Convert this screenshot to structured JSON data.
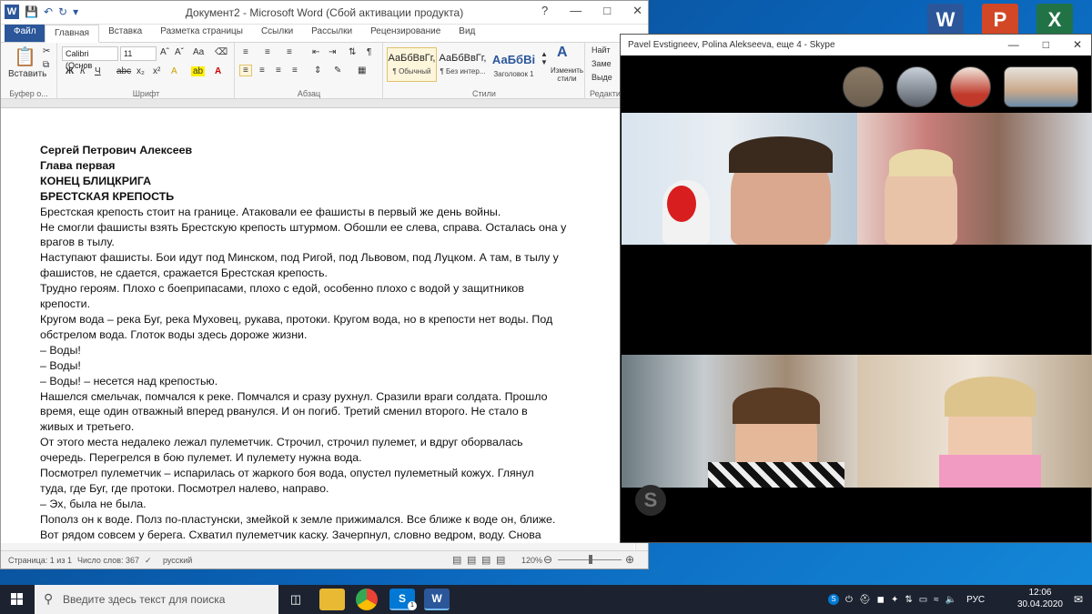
{
  "word": {
    "title": "Документ2 - Microsoft Word (Сбой активации продукта)",
    "tabs": [
      "Файл",
      "Главная",
      "Вставка",
      "Разметка страницы",
      "Ссылки",
      "Рассылки",
      "Рецензирование",
      "Вид"
    ],
    "ribbon": {
      "paste_label": "Вставить",
      "clipboard_group": "Буфер о...",
      "font_name": "Calibri (Основ",
      "font_size": "11",
      "font_group": "Шрифт",
      "paragraph_group": "Абзац",
      "styles_group": "Стили",
      "editing_group": "Редактир",
      "styles": [
        {
          "preview": "АаБбВвГг,",
          "name": "¶ Обычный"
        },
        {
          "preview": "АаБбВвГг,",
          "name": "¶ Без интер..."
        },
        {
          "preview": "АаБбВі",
          "name": "Заголовок 1"
        }
      ],
      "change_styles": "Изменить стили",
      "find": "Найт",
      "replace": "Заме",
      "select": "Выде"
    },
    "document_lines": [
      {
        "text": "Сергей Петрович Алексеев",
        "bold": true
      },
      {
        "text": "Глава первая",
        "bold": true
      },
      {
        "text": "КОНЕЦ БЛИЦКРИГА",
        "bold": true
      },
      {
        "text": "БРЕСТСКАЯ КРЕПОСТЬ",
        "bold": true
      },
      {
        "text": "Брестская крепость стоит на границе. Атаковали ее фашисты в первый же день войны.",
        "bold": false
      },
      {
        "text": "Не смогли фашисты взять Брестскую крепость штурмом. Обошли ее слева, справа. Осталась она у",
        "bold": false
      },
      {
        "text": "врагов в тылу.",
        "bold": false
      },
      {
        "text": "Наступают фашисты. Бои идут под Минском, под Ригой, под Львовом, под Луцком. А там, в тылу у",
        "bold": false
      },
      {
        "text": "фашистов, не сдается, сражается Брестская крепость.",
        "bold": false
      },
      {
        "text": "Трудно героям. Плохо с боеприпасами, плохо с едой, особенно плохо с водой у защитников",
        "bold": false
      },
      {
        "text": "крепости.",
        "bold": false
      },
      {
        "text": "Кругом вода – река Буг, река Муховец, рукава, протоки. Кругом вода, но в крепости нет воды. Под",
        "bold": false
      },
      {
        "text": "обстрелом вода. Глоток воды здесь дороже жизни.",
        "bold": false
      },
      {
        "text": "– Воды!",
        "bold": false
      },
      {
        "text": "– Воды!",
        "bold": false
      },
      {
        "text": "– Воды! – несется над крепостью.",
        "bold": false
      },
      {
        "text": "Нашелся смельчак, помчался к реке. Помчался и сразу рухнул. Сразили враги солдата. Прошло",
        "bold": false
      },
      {
        "text": "время, еще один отважный вперед рванулся. И он погиб. Третий сменил второго. Не стало в",
        "bold": false
      },
      {
        "text": "живых и третьего.",
        "bold": false
      },
      {
        "text": "От этого места недалеко лежал пулеметчик. Строчил, строчил пулемет, и вдруг оборвалась",
        "bold": false
      },
      {
        "text": "очередь. Перегрелся в бою пулемет. И пулемету нужна вода.",
        "bold": false
      },
      {
        "text": "Посмотрел пулеметчик – испарилась от жаркого боя вода, опустел пулеметный кожух. Глянул",
        "bold": false
      },
      {
        "text": "туда, где Буг, где протоки. Посмотрел налево, направо.",
        "bold": false
      },
      {
        "text": "– Эх, была не была.",
        "bold": false
      },
      {
        "text": "Пополз он к воде. Полз по-пластунски, змейкой к земле прижимался. Все ближе к воде он, ближе.",
        "bold": false
      },
      {
        "text": "Вот рядом совсем у берега. Схватил пулеметчик каску. Зачерпнул, словно ведром, воду. Снова",
        "bold": false
      }
    ],
    "status": {
      "page": "Страница: 1 из 1",
      "words": "Число слов: 367",
      "language": "русский",
      "zoom": "120%"
    }
  },
  "skype": {
    "title": "Pavel  Evstigneev, Polina Alekseeva, еще 4 - Skype"
  },
  "desktop_icons": [
    {
      "name": "word-desktop-icon",
      "letter": "W",
      "color": "#2b579a"
    },
    {
      "name": "powerpoint-desktop-icon",
      "letter": "P",
      "color": "#d24726"
    },
    {
      "name": "excel-desktop-icon",
      "letter": "X",
      "color": "#217346"
    }
  ],
  "taskbar": {
    "search_placeholder": "Введите здесь текст для поиска",
    "language": "РУС",
    "time": "12:06",
    "date": "30.04.2020",
    "skype_badge": "1"
  }
}
